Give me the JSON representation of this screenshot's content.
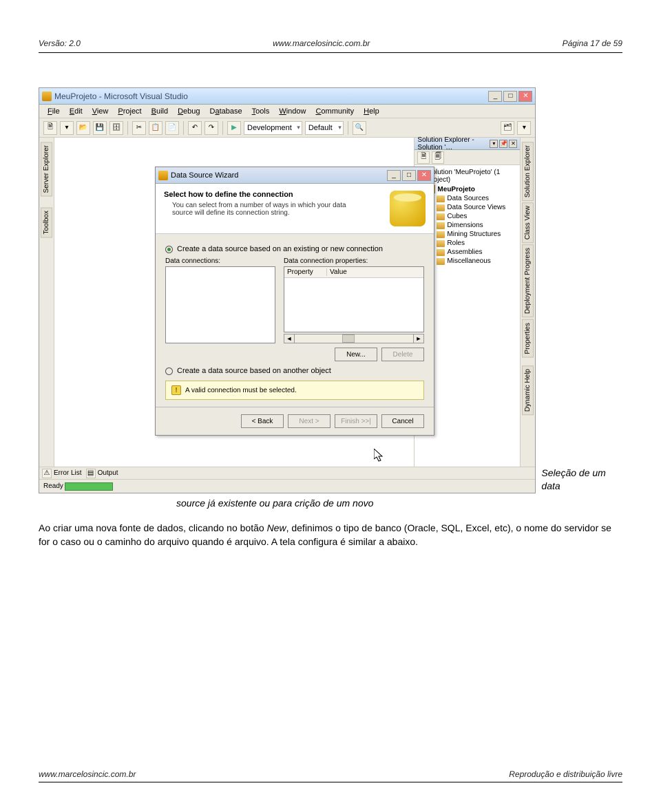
{
  "doc": {
    "version": "Versão: 2.0",
    "site_top": "www.marcelosincic.com.br",
    "page": "Página 17 de 59",
    "site_bottom": "www.marcelosincic.com.br",
    "rights": "Reprodução e distribuição livre"
  },
  "window": {
    "title": "MeuProjeto - Microsoft Visual Studio"
  },
  "menu": {
    "items": [
      "File",
      "Edit",
      "View",
      "Project",
      "Build",
      "Debug",
      "Database",
      "Tools",
      "Window",
      "Community",
      "Help"
    ]
  },
  "toolbar": {
    "config_label": "Development",
    "config_label2": "Default"
  },
  "left_tabs": {
    "server_explorer": "Server Explorer",
    "toolbox": "Toolbox"
  },
  "sol_explorer": {
    "title": "Solution Explorer - Solution '…",
    "solution": "Solution 'MeuProjeto' (1 project)",
    "project": "MeuProjeto",
    "nodes": [
      "Data Sources",
      "Data Source Views",
      "Cubes",
      "Dimensions",
      "Mining Structures",
      "Roles",
      "Assemblies",
      "Miscellaneous"
    ]
  },
  "right_tabs": {
    "solution_explorer": "Solution Explorer",
    "class_view": "Class View",
    "deployment_progress": "Deployment Progress",
    "properties": "Properties",
    "dynamic_help": "Dynamic Help"
  },
  "dialog": {
    "title": "Data Source Wizard",
    "heading": "Select how to define the connection",
    "subtext": "You can select from a number of ways in which your data source will define its connection string.",
    "radio1": "Create a data source based on an existing or new connection",
    "label_connections": "Data connections:",
    "label_props": "Data connection properties:",
    "prop_col1": "Property",
    "prop_col2": "Value",
    "btn_new": "New...",
    "btn_delete": "Delete",
    "radio2": "Create a data source based on another object",
    "warning": "A valid connection must be selected.",
    "btn_back": "< Back",
    "btn_next": "Next >",
    "btn_finish": "Finish >>|",
    "btn_cancel": "Cancel"
  },
  "bottom": {
    "error_list": "Error List",
    "output": "Output",
    "status": "Ready"
  },
  "caption": {
    "right": "Seleção de um data",
    "below": "source já existente ou para crição de um novo"
  },
  "para": {
    "t1": "Ao criar uma nova fonte de dados, clicando no botão ",
    "em": "New",
    "t2": ", definimos o tipo de banco (Oracle, SQL, Excel, etc), o nome do servidor se for o caso ou o caminho do arquivo quando é arquivo. A tela configura é similar a abaixo."
  }
}
